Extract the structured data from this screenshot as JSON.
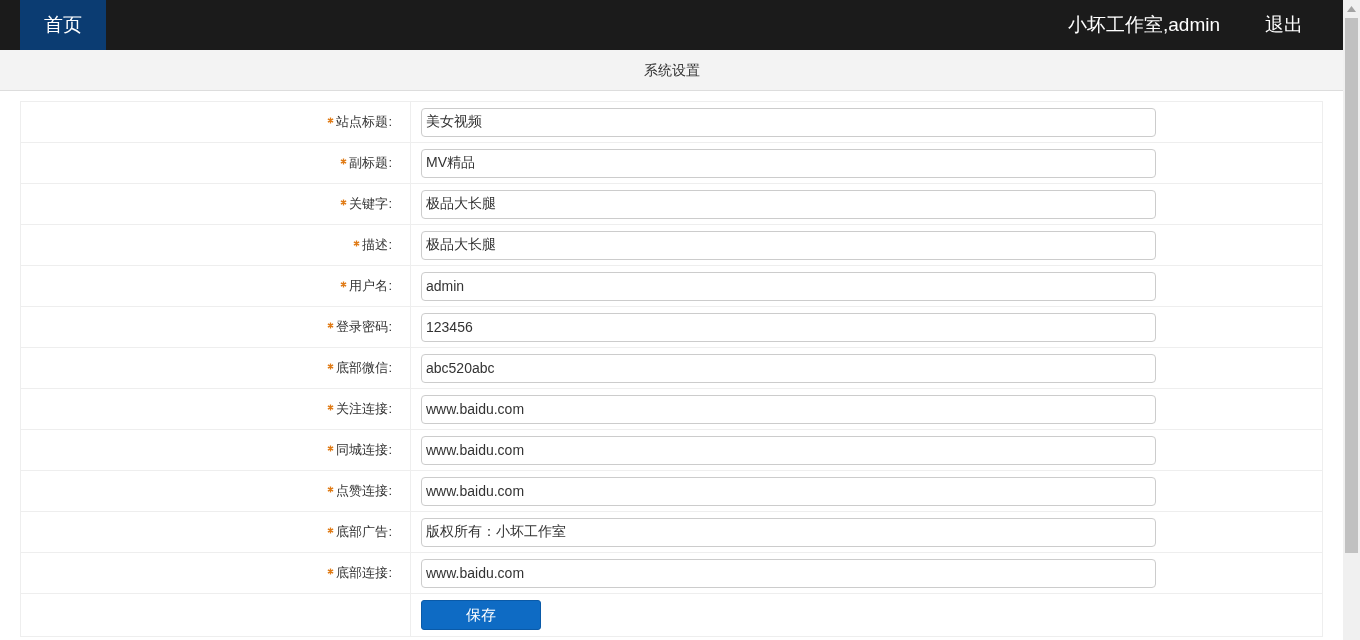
{
  "nav": {
    "home": {
      "label": "首页",
      "selected": true
    },
    "user": "小坏工作室,admin",
    "logout": "退出"
  },
  "title": "系统设置",
  "fields": [
    {
      "label": "站点标题:",
      "required": true,
      "value": "美女视频"
    },
    {
      "label": "副标题:",
      "required": true,
      "value": "MV精品"
    },
    {
      "label": "关键字:",
      "required": true,
      "value": "极品大长腿"
    },
    {
      "label": "描述:",
      "required": true,
      "value": "极品大长腿"
    },
    {
      "label": "用户名:",
      "required": true,
      "value": "admin"
    },
    {
      "label": "登录密码:",
      "required": true,
      "value": "123456"
    },
    {
      "label": "底部微信:",
      "required": true,
      "value": "abc520abc"
    },
    {
      "label": "关注连接:",
      "required": true,
      "value": "www.baidu.com"
    },
    {
      "label": "同城连接:",
      "required": true,
      "value": "www.baidu.com"
    },
    {
      "label": "点赞连接:",
      "required": true,
      "value": "www.baidu.com"
    },
    {
      "label": "底部广告:",
      "required": true,
      "value": "版权所有：小坏工作室"
    },
    {
      "label": "底部连接:",
      "required": true,
      "value": "www.baidu.com"
    }
  ],
  "save_button": "保存"
}
